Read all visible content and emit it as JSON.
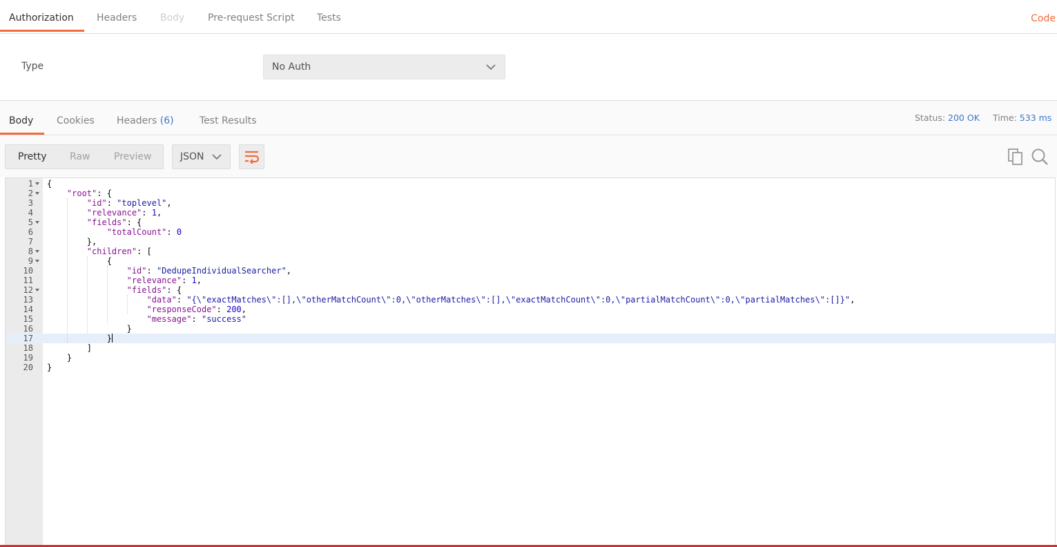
{
  "request_tabs": {
    "items": [
      {
        "label": "Authorization",
        "active": true
      },
      {
        "label": "Headers",
        "active": false
      },
      {
        "label": "Body",
        "disabled": true
      },
      {
        "label": "Pre-request Script",
        "active": false
      },
      {
        "label": "Tests",
        "active": false
      }
    ],
    "code_link": "Code"
  },
  "authorization": {
    "type_label": "Type",
    "selected": "No Auth"
  },
  "response_tabs": {
    "items": [
      {
        "label": "Body",
        "active": true
      },
      {
        "label": "Cookies"
      },
      {
        "label": "Headers",
        "count": "(6)"
      },
      {
        "label": "Test Results"
      }
    ],
    "status_label": "Status:",
    "status_value": "200 OK",
    "time_label": "Time:",
    "time_value": "533 ms"
  },
  "toolbar": {
    "view_modes": [
      "Pretty",
      "Raw",
      "Preview"
    ],
    "active_view": "Pretty",
    "format": "JSON",
    "icons": [
      "wrap-lines-icon",
      "copy-icon",
      "search-icon"
    ]
  },
  "editor": {
    "highlighted_line": 17,
    "lines": [
      {
        "n": "1",
        "fold": true,
        "tokens": [
          [
            "p",
            "{"
          ]
        ]
      },
      {
        "n": "2",
        "fold": true,
        "tokens": [
          [
            "p",
            "    "
          ],
          [
            "k",
            "\"root\""
          ],
          [
            "p",
            ": {"
          ]
        ]
      },
      {
        "n": "3",
        "fold": false,
        "tokens": [
          [
            "p",
            "        "
          ],
          [
            "k",
            "\"id\""
          ],
          [
            "p",
            ": "
          ],
          [
            "s",
            "\"toplevel\""
          ],
          [
            "p",
            ","
          ]
        ]
      },
      {
        "n": "4",
        "fold": false,
        "tokens": [
          [
            "p",
            "        "
          ],
          [
            "k",
            "\"relevance\""
          ],
          [
            "p",
            ": "
          ],
          [
            "n",
            "1"
          ],
          [
            "p",
            ","
          ]
        ]
      },
      {
        "n": "5",
        "fold": true,
        "tokens": [
          [
            "p",
            "        "
          ],
          [
            "k",
            "\"fields\""
          ],
          [
            "p",
            ": {"
          ]
        ]
      },
      {
        "n": "6",
        "fold": false,
        "tokens": [
          [
            "p",
            "            "
          ],
          [
            "k",
            "\"totalCount\""
          ],
          [
            "p",
            ": "
          ],
          [
            "n",
            "0"
          ]
        ]
      },
      {
        "n": "7",
        "fold": false,
        "tokens": [
          [
            "p",
            "        },"
          ]
        ]
      },
      {
        "n": "8",
        "fold": true,
        "tokens": [
          [
            "p",
            "        "
          ],
          [
            "k",
            "\"children\""
          ],
          [
            "p",
            ": ["
          ]
        ]
      },
      {
        "n": "9",
        "fold": true,
        "tokens": [
          [
            "p",
            "            {"
          ]
        ]
      },
      {
        "n": "10",
        "fold": false,
        "tokens": [
          [
            "p",
            "                "
          ],
          [
            "k",
            "\"id\""
          ],
          [
            "p",
            ": "
          ],
          [
            "s",
            "\"DedupeIndividualSearcher\""
          ],
          [
            "p",
            ","
          ]
        ]
      },
      {
        "n": "11",
        "fold": false,
        "tokens": [
          [
            "p",
            "                "
          ],
          [
            "k",
            "\"relevance\""
          ],
          [
            "p",
            ": "
          ],
          [
            "n",
            "1"
          ],
          [
            "p",
            ","
          ]
        ]
      },
      {
        "n": "12",
        "fold": true,
        "tokens": [
          [
            "p",
            "                "
          ],
          [
            "k",
            "\"fields\""
          ],
          [
            "p",
            ": {"
          ]
        ]
      },
      {
        "n": "13",
        "fold": false,
        "tokens": [
          [
            "p",
            "                    "
          ],
          [
            "k",
            "\"data\""
          ],
          [
            "p",
            ": "
          ],
          [
            "s",
            "\"{\\\"exactMatches\\\":[],\\\"otherMatchCount\\\":0,\\\"otherMatches\\\":[],\\\"exactMatchCount\\\":0,\\\"partialMatchCount\\\":0,\\\"partialMatches\\\":[]}\""
          ],
          [
            "p",
            ","
          ]
        ]
      },
      {
        "n": "14",
        "fold": false,
        "tokens": [
          [
            "p",
            "                    "
          ],
          [
            "k",
            "\"responseCode\""
          ],
          [
            "p",
            ": "
          ],
          [
            "n",
            "200"
          ],
          [
            "p",
            ","
          ]
        ]
      },
      {
        "n": "15",
        "fold": false,
        "tokens": [
          [
            "p",
            "                    "
          ],
          [
            "k",
            "\"message\""
          ],
          [
            "p",
            ": "
          ],
          [
            "s",
            "\"success\""
          ]
        ]
      },
      {
        "n": "16",
        "fold": false,
        "tokens": [
          [
            "p",
            "                }"
          ]
        ]
      },
      {
        "n": "17",
        "fold": false,
        "tokens": [
          [
            "p",
            "            }"
          ]
        ]
      },
      {
        "n": "18",
        "fold": false,
        "tokens": [
          [
            "p",
            "        ]"
          ]
        ]
      },
      {
        "n": "19",
        "fold": false,
        "tokens": [
          [
            "p",
            "    }"
          ]
        ]
      },
      {
        "n": "20",
        "fold": false,
        "tokens": [
          [
            "p",
            "}"
          ]
        ]
      }
    ]
  }
}
